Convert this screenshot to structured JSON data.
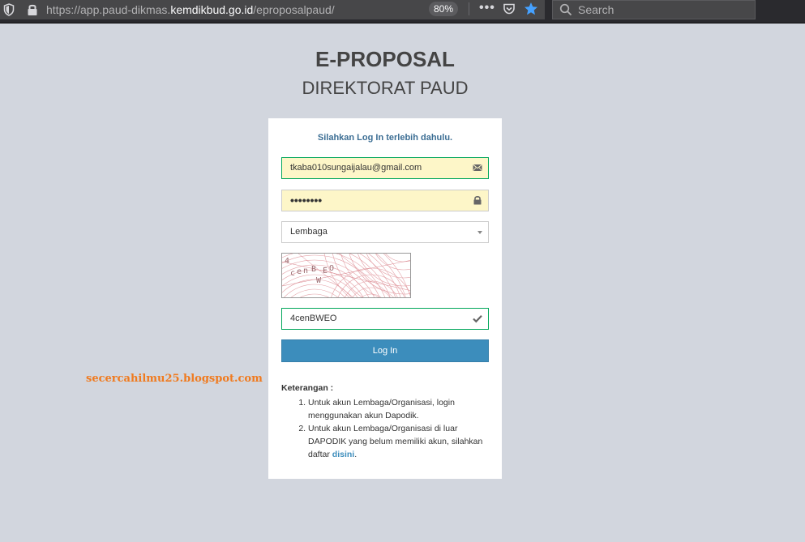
{
  "browser": {
    "url_prefix": "https://app.paud-dikmas.",
    "url_domain": "kemdikbud.go.id",
    "url_suffix": "/eproposalpaud/",
    "zoom": "80%",
    "search_placeholder": "Search"
  },
  "page": {
    "title": "E-PROPOSAL",
    "subtitle": "DIREKTORAT PAUD"
  },
  "login": {
    "message": "Silahkan Log In terlebih dahulu.",
    "email_value": "tkaba010sungaijalau@gmail.com",
    "password_mask": "••••••••",
    "select_value": "Lembaga",
    "captcha_text": "4cenBWEO",
    "captcha_input_value": "4cenBWEO",
    "button_label": "Log In"
  },
  "notes": {
    "heading": "Keterangan :",
    "item1": "Untuk akun Lembaga/Organisasi, login menggunakan akun Dapodik.",
    "item2_text": "Untuk akun Lembaga/Organisasi di luar DAPODIK yang belum memiliki akun, silahkan daftar ",
    "item2_link": "disini",
    "item2_end": "."
  },
  "watermark": "secercahilmu25.blogspot.com"
}
